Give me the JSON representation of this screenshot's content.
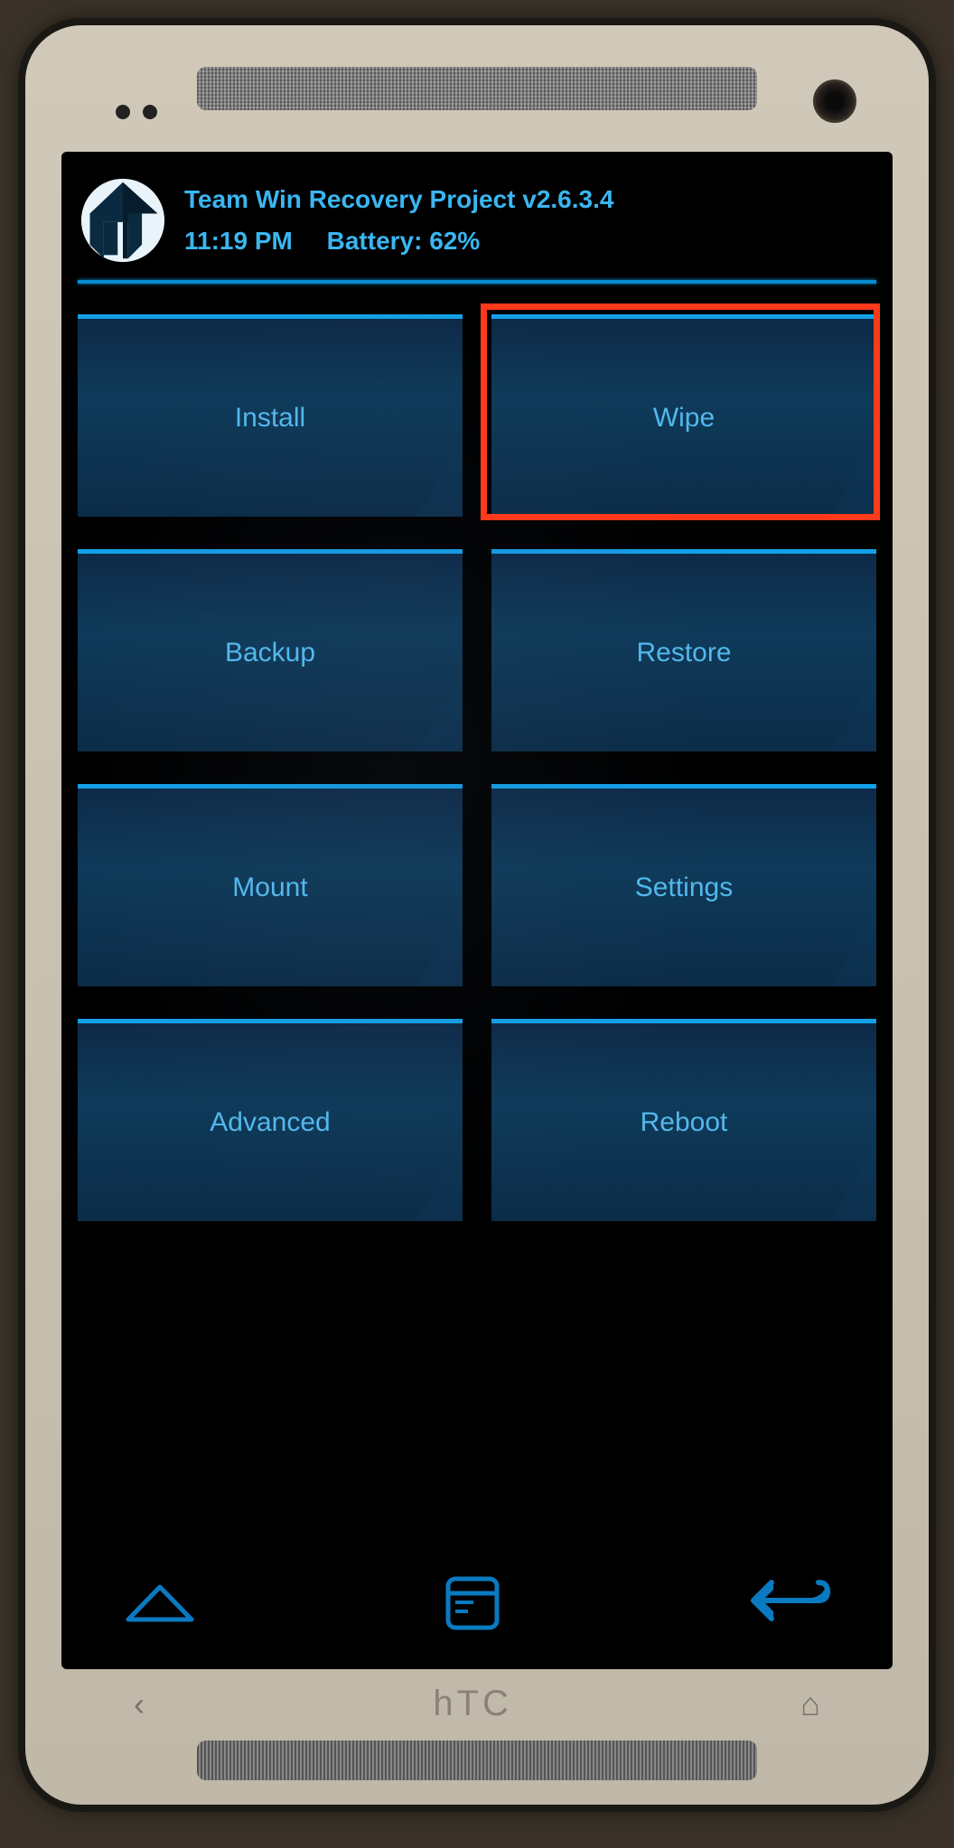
{
  "header": {
    "title": "Team Win Recovery Project  v2.6.3.4",
    "time": "11:19 PM",
    "battery": "Battery: 62%"
  },
  "buttons": [
    {
      "label": "Install"
    },
    {
      "label": "Wipe"
    },
    {
      "label": "Backup"
    },
    {
      "label": "Restore"
    },
    {
      "label": "Mount"
    },
    {
      "label": "Settings"
    },
    {
      "label": "Advanced"
    },
    {
      "label": "Reboot"
    }
  ],
  "highlight_index": 1,
  "device_brand": "hTC",
  "colors": {
    "accent": "#14a0e8",
    "button_text": "#52b8ec",
    "highlight": "#ff3a1a"
  }
}
